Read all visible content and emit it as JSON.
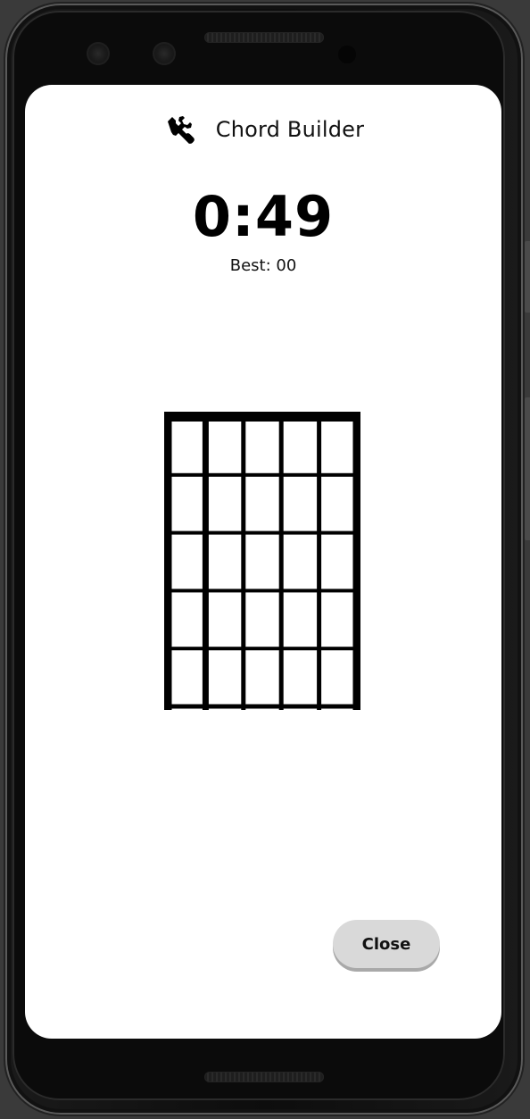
{
  "app": {
    "title": "Chord Builder",
    "title_icon": "wrench-icon"
  },
  "timer": {
    "display": "0:49"
  },
  "best": {
    "text": "Best: 00"
  },
  "fretboard": {
    "strings": 6,
    "frets": 5
  },
  "actions": {
    "close_label": "Close"
  },
  "colors": {
    "screen_bg": "#ffffff",
    "text": "#000000",
    "button_bg": "#d9d9d9",
    "device_frame": "#0b0b0b"
  }
}
